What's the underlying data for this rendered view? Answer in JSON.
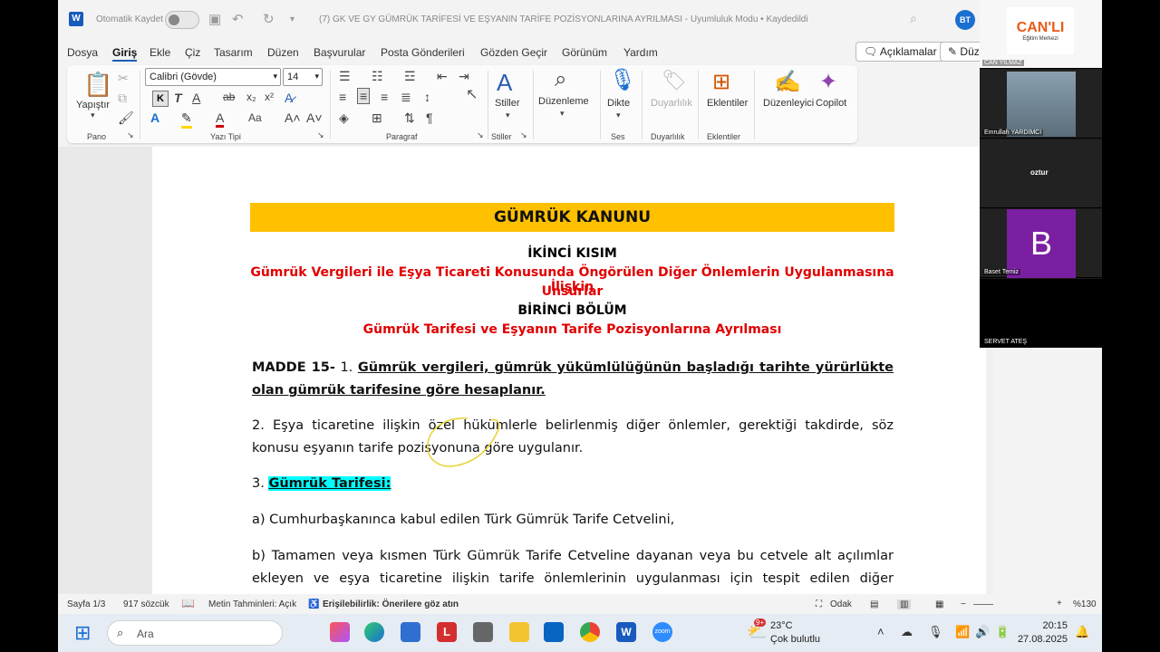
{
  "titlebar": {
    "autosave_label": "Otomatik Kaydet",
    "doc_title": "(7) GK VE GY GÜMRÜK TARİFESİ VE EŞYANIN TARİFE POZİSYONLARINA AYRILMASI  -  Uyumluluk Modu • Kaydedildi",
    "avatar_initials": "BT"
  },
  "menu": {
    "tabs": [
      "Dosya",
      "Giriş",
      "Ekle",
      "Çiz",
      "Tasarım",
      "Düzen",
      "Başvurular",
      "Posta Gönderileri",
      "Gözden Geçir",
      "Görünüm",
      "Yardım"
    ],
    "comments_btn": "Açıklamalar",
    "edit_btn": "Düze"
  },
  "ribbon": {
    "paste_label": "Yapıştır",
    "clipboard_group": "Pano",
    "font_name": "Calibri (Gövde)",
    "font_size": "14",
    "bold": "K",
    "font_group": "Yazı Tipi",
    "paragraph_group": "Paragraf",
    "styles_label": "Stiller",
    "styles_group": "Stiller",
    "editing_label": "Düzenleme",
    "dictate_label": "Dikte",
    "voice_group": "Ses",
    "sensitivity_label": "Duyarlılık",
    "sensitivity_group": "Duyarlılık",
    "addins_label": "Eklentiler",
    "addins_group": "Eklentiler",
    "editor_label": "Düzenleyici",
    "copilot_label": "Copilot"
  },
  "document": {
    "banner": "GÜMRÜK KANUNU",
    "part": "İKİNCİ KISIM",
    "part_title_1": "Gümrük Vergileri ile Eşya Ticareti Konusunda Öngörülen Diğer Önlemlerin Uygulanmasına İlişkin",
    "part_title_2": "Unsurlar",
    "section": "BİRİNCİ BÖLÜM",
    "section_title": "Gümrük Tarifesi ve Eşyanın Tarife Pozisyonlarına Ayrılması",
    "article_label": "MADDE 15-",
    "article_num": " 1. ",
    "article_text": "Gümrük vergileri, gümrük yükümlülüğünün başladığı tarihte yürürlükte olan gümrük tarifesine göre hesaplanır.",
    "para2": "2. Eşya ticaretine ilişkin özel hükümlerle belirlenmiş diğer önlemler, gerektiği takdirde, söz konusu eşyanın tarife pozisyonuna göre uygulanır.",
    "para3_num": "3. ",
    "para3_text": "Gümrük Tarifesi:",
    "item_a": "a) Cumhurbaşkanınca kabul edilen Türk Gümrük Tarife Cetvelini,",
    "item_b": "b) Tamamen veya kısmen Türk Gümrük Tarife Cetveline dayanan veya bu cetvele alt açılımlar ekleyen ve eşya ticaretine ilişkin tarife önlemlerinin uygulanması için tespit edilen diğer cetvelleri,"
  },
  "statusbar": {
    "page": "Sayfa 1/3",
    "words": "917 sözcük",
    "predictions": "Metin Tahminleri: Açık",
    "accessibility": "Erişilebilirlik: Önerilere göz atın",
    "focus": "Odak",
    "zoom": "%130"
  },
  "taskbar": {
    "search_placeholder": "Ara",
    "badge": "9+",
    "temperature": "23°C",
    "weather": "Çok bulutlu",
    "time": "20:15",
    "date": "27.08.2025"
  },
  "video": {
    "logo_text": "CAN'LI",
    "logo_sub": "Eğitim Merkezi",
    "tiles": [
      "CAN YILMAZ",
      "Emrullah YARDIMCI",
      "oztur",
      "Baset Temiz",
      "SERVET ATEŞ"
    ],
    "avatar_letter": "B"
  },
  "colors": {
    "banner": "#ffc000",
    "red_heading": "#e00000",
    "highlight": "#00ffff",
    "word_blue": "#185abd"
  }
}
